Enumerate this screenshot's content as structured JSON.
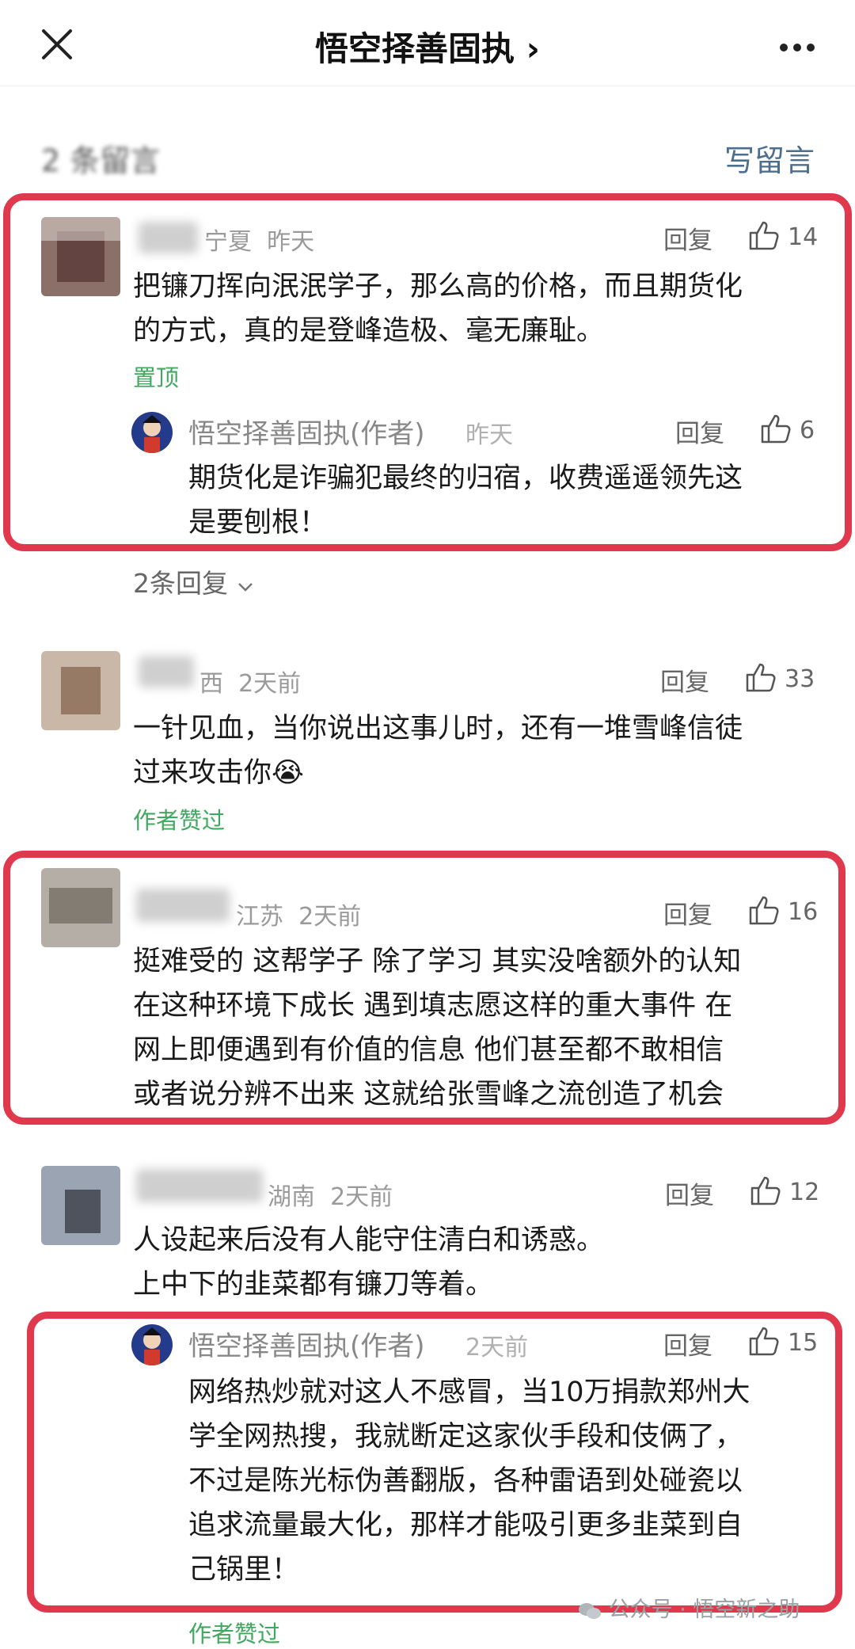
{
  "nav": {
    "title": "悟空择善固执 ›"
  },
  "comments_header": {
    "count_label": "2 条留言",
    "write_label": "写留言"
  },
  "comments": [
    {
      "name": "",
      "location": "宁夏",
      "time": "昨天",
      "reply": "回复",
      "likes": "14",
      "text_lines": [
        "把镰刀挥向泯泯学子，那么高的价格，而且期货化",
        "的方式，真的是登峰造极、毫无廉耻。"
      ],
      "tag": "置顶",
      "author_reply": {
        "name": "悟空择善固执(作者)",
        "time": "昨天",
        "reply": "回复",
        "likes": "6",
        "text_lines": [
          "期货化是诈骗犯最终的归宿，收费遥遥领先这",
          "是要刨根！"
        ]
      },
      "more_replies": "2条回复"
    },
    {
      "name": "",
      "location": "西",
      "time": "2天前",
      "reply": "回复",
      "likes": "33",
      "text_lines": [
        "一针见血，当你说出这事儿时，还有一堆雪峰信徒",
        "过来攻击你😭"
      ],
      "tag": "作者赞过"
    },
    {
      "name": "",
      "location": "江苏",
      "time": "2天前",
      "reply": "回复",
      "likes": "16",
      "text_lines": [
        "挺难受的 这帮学子 除了学习 其实没啥额外的认知",
        "在这种环境下成长 遇到填志愿这样的重大事件 在",
        "网上即便遇到有价值的信息 他们甚至都不敢相信",
        "或者说分辨不出来 这就给张雪峰之流创造了机会"
      ]
    },
    {
      "name": "",
      "location": "湖南",
      "time": "2天前",
      "reply": "回复",
      "likes": "12",
      "text_lines": [
        "人设起来后没有人能守住清白和诱惑。",
        "上中下的韭菜都有镰刀等着。"
      ],
      "author_reply": {
        "name": "悟空择善固执(作者)",
        "time": "2天前",
        "reply": "回复",
        "likes": "15",
        "text_lines": [
          "网络热炒就对这人不感冒，当10万捐款郑州大",
          "学全网热搜，我就断定这家伙手段和伎俩了，",
          "不过是陈光标伪善翻版，各种雷语到处碰瓷以",
          "追求流量最大化，那样才能吸引更多韭菜到自",
          "己锅里！"
        ]
      },
      "tag": "作者赞过"
    }
  ],
  "watermark": "公众号 · 悟空新之助",
  "colors": {
    "highlight": "#e0394e",
    "green": "#41a85f",
    "link": "#4d6f8e"
  }
}
